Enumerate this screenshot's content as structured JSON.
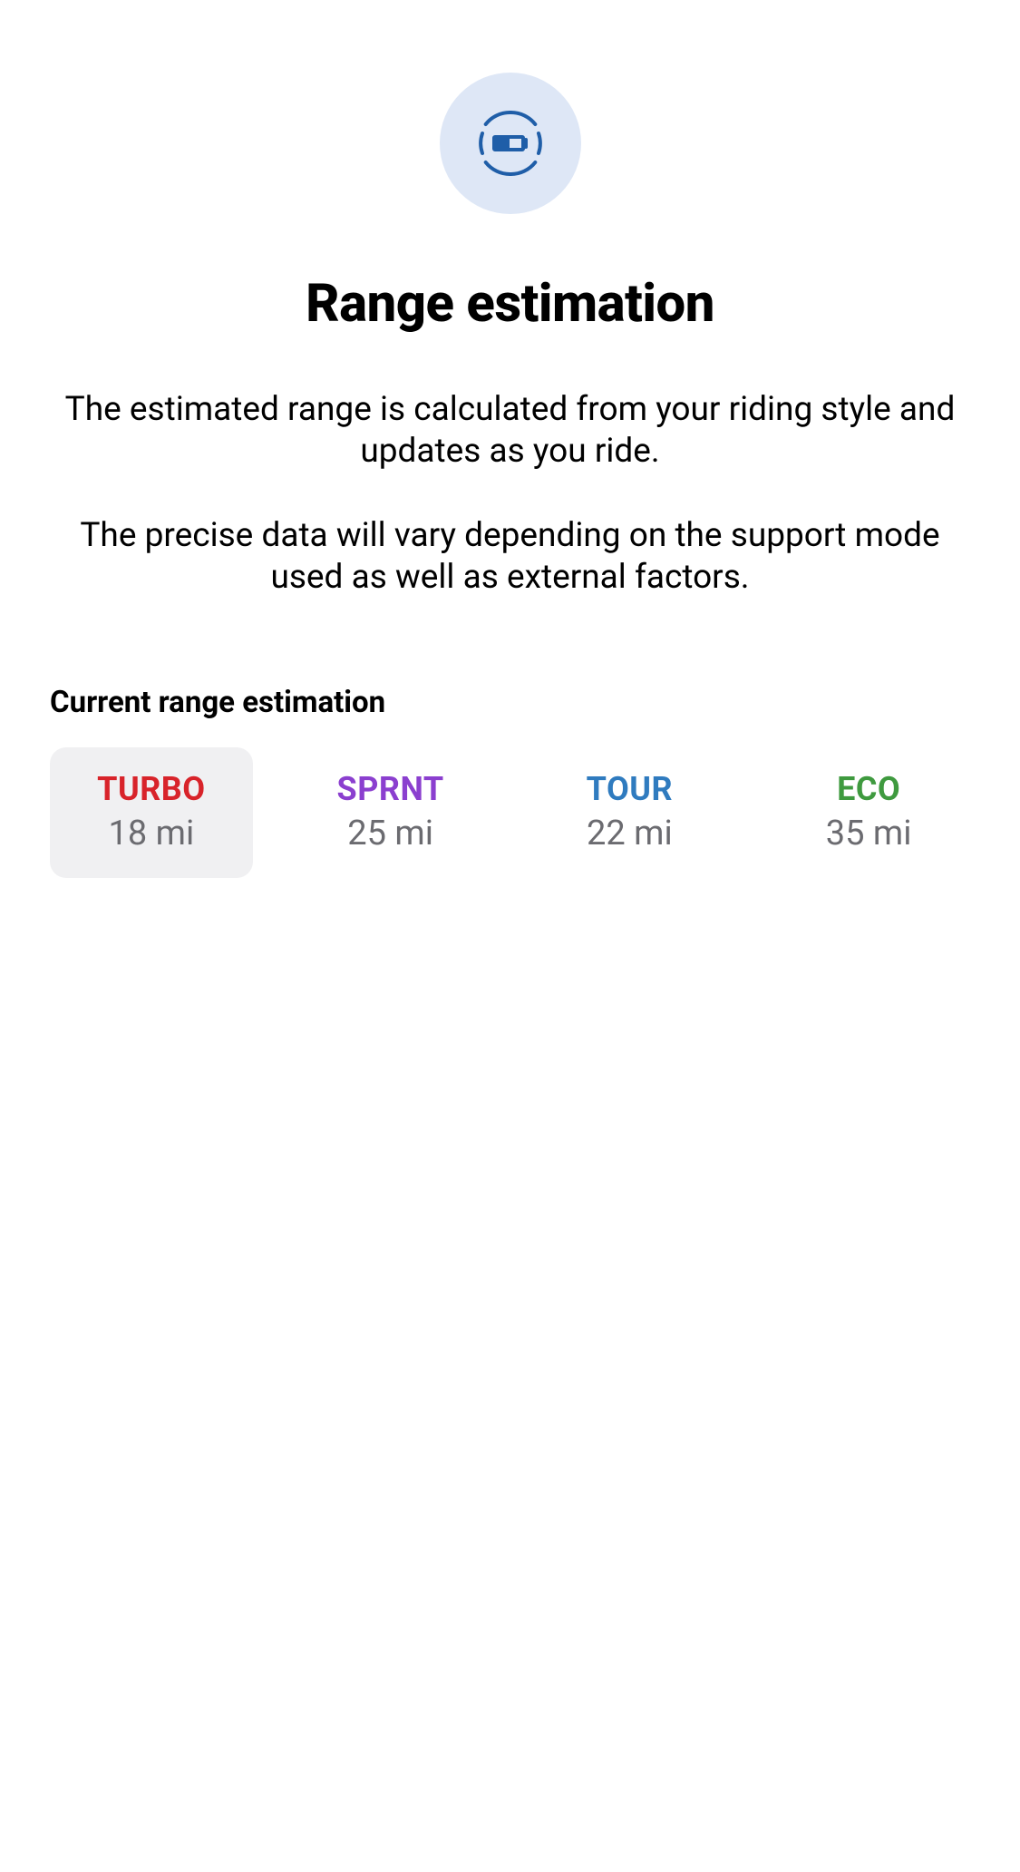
{
  "header": {
    "icon_name": "battery-gauge-icon",
    "title": "Range estimation",
    "description_p1": "The estimated range is calculated from your riding style and updates as you ride.",
    "description_p2": "The precise data will vary depending on the support mode used as well as external factors."
  },
  "section": {
    "heading": "Current range estimation"
  },
  "modes": [
    {
      "key": "turbo",
      "label": "TURBO",
      "value": "18 mi",
      "color": "#d8232a",
      "selected": true
    },
    {
      "key": "sprnt",
      "label": "SPRNT",
      "value": "25 mi",
      "color": "#8b3fcf",
      "selected": false
    },
    {
      "key": "tour",
      "label": "TOUR",
      "value": "22 mi",
      "color": "#2f7bbf",
      "selected": false
    },
    {
      "key": "eco",
      "label": "ECO",
      "value": "35 mi",
      "color": "#3f9a3f",
      "selected": false
    }
  ]
}
